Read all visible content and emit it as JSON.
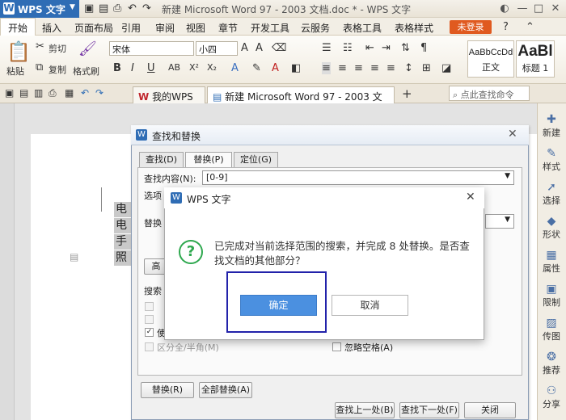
{
  "app": {
    "brand": "WPS 文字",
    "doc_title": "新建 Microsoft Word 97 - 2003 文档.doc * - WPS 文字"
  },
  "menu": {
    "items": [
      "开始",
      "插入",
      "页面布局",
      "引用",
      "审阅",
      "视图",
      "章节",
      "开发工具",
      "云服务",
      "表格工具",
      "表格样式"
    ],
    "login": "未登录"
  },
  "ribbon": {
    "paste": "粘贴",
    "cut": "剪切",
    "copy": "复制",
    "format_painter": "格式刷",
    "font_name": "宋体",
    "font_size": "小四",
    "styles": [
      {
        "preview": "AaBbCcDd",
        "label": "正文"
      },
      {
        "preview": "AaBl",
        "label": "标题 1"
      }
    ]
  },
  "tabs": {
    "my_wps": "我的WPS",
    "doc": "新建 Microsoft Word 97 - 2003 文档 *",
    "search_cmd": "点此查找命令"
  },
  "document": {
    "lines": [
      "电话",
      "电话",
      "手机",
      "照片"
    ]
  },
  "sidepanel": {
    "items": [
      "新建",
      "样式",
      "选择",
      "形状",
      "属性",
      "限制",
      "传图",
      "推荐",
      "分享"
    ]
  },
  "find_replace": {
    "title": "查找和替换",
    "tabs": [
      "查找(D)",
      "替换(P)",
      "定位(G)"
    ],
    "find_label": "查找内容(N):",
    "find_value": "[0-9]",
    "options_label": "选项",
    "replace_label": "替换",
    "advanced_btn": "高",
    "search_label": "搜索",
    "opt_checkbox_3": "使",
    "halfwidth": "区分全/半角(M)",
    "ignore_space": "忽略空格(A)",
    "replace_btn": "替换(R)",
    "replace_all_btn": "全部替换(A)",
    "find_prev_btn": "查找上一处(B)",
    "find_next_btn": "查找下一处(F)",
    "close_btn": "关闭"
  },
  "modal": {
    "title": "WPS 文字",
    "message": "已完成对当前选择范围的搜索，并完成 8 处替换。是否查找文档的其他部分？",
    "ok": "确定",
    "cancel": "取消"
  },
  "colors": {
    "accent_blue": "#4b90e0",
    "highlight_box": "#2222aa",
    "wps_brand": "#2f6db5",
    "login": "#e05a20"
  }
}
